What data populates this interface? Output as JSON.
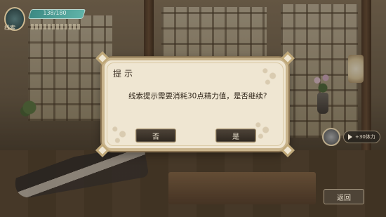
{
  "hud": {
    "energy_text": "138/180",
    "emblem_label": "线索"
  },
  "side_action": {
    "label": "+30体力"
  },
  "back_button": {
    "label": "返回"
  },
  "dialog": {
    "title": "提示",
    "message": "线索提示需要消耗30点精力值，是否继续?",
    "no_label": "否",
    "yes_label": "是"
  }
}
